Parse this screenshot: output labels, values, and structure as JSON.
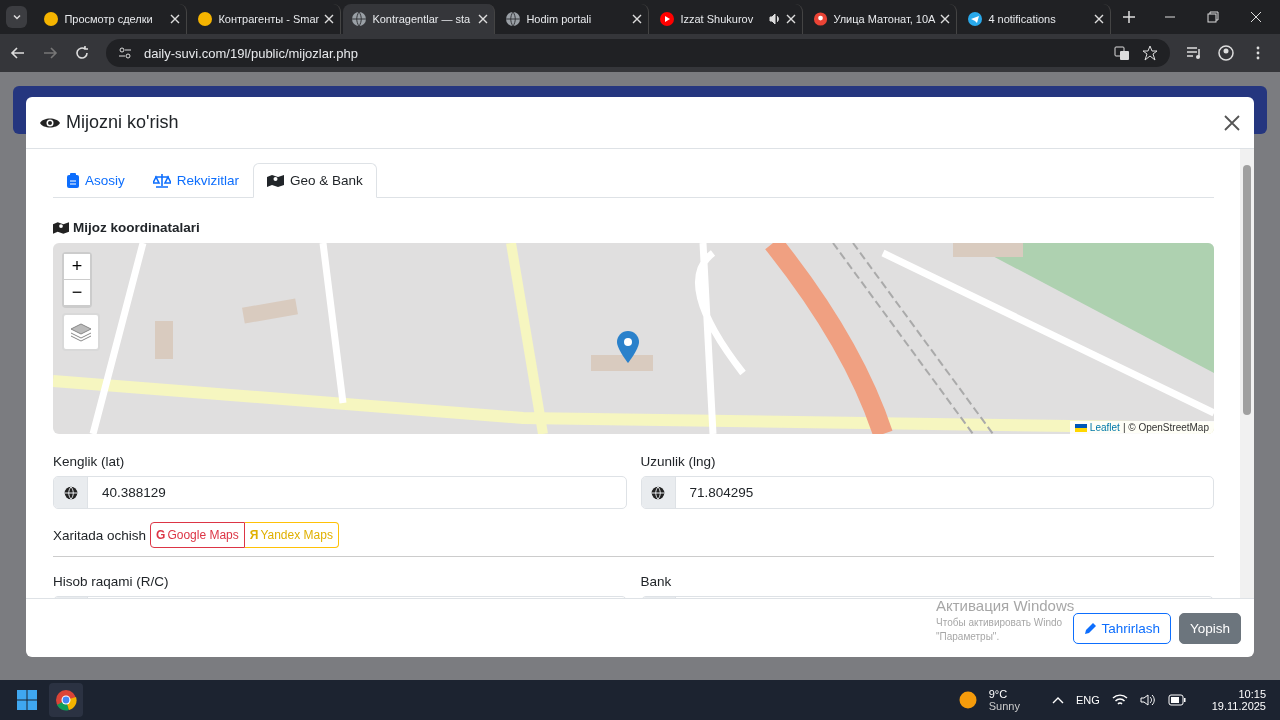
{
  "browser": {
    "tabs": [
      {
        "title": "Просмотр сделки",
        "kind": "app",
        "selected": false,
        "audio": false
      },
      {
        "title": "Контрагенты - Smar",
        "kind": "app",
        "selected": false,
        "audio": false
      },
      {
        "title": "Kontragentlar — sta",
        "kind": "globe",
        "selected": true,
        "audio": false
      },
      {
        "title": "Hodim portali",
        "kind": "globe",
        "selected": false,
        "audio": false
      },
      {
        "title": "Izzat Shukurov",
        "kind": "youtube",
        "selected": false,
        "audio": true
      },
      {
        "title": "Улица Матонат, 10А",
        "kind": "maps",
        "selected": false,
        "audio": false
      },
      {
        "title": "4 notifications",
        "kind": "telegram",
        "selected": false,
        "audio": false
      }
    ],
    "url": "daily-suvi.com/19l/public/mijozlar.php"
  },
  "modal": {
    "title": "Mijozni ko'rish",
    "tabs": [
      {
        "label": "Asosiy",
        "selected": false
      },
      {
        "label": "Rekvizitlar",
        "selected": false
      },
      {
        "label": "Geo & Bank",
        "selected": true
      }
    ],
    "section_title": "Mijoz koordinatalari",
    "map": {
      "zoom_in": "+",
      "zoom_out": "−",
      "attribution_link": "Leaflet",
      "attribution_text": "| © OpenStreetMap"
    },
    "coord_fields": [
      {
        "label": "Kenglik (lat)",
        "value": "40.388129"
      },
      {
        "label": "Uzunlik (lng)",
        "value": "71.804295"
      }
    ],
    "open_in": {
      "label": "Xaritada ochish",
      "links": [
        {
          "label": "Google Maps",
          "icon": "G",
          "kind": "google"
        },
        {
          "label": "Yandex Maps",
          "icon": "Я",
          "kind": "yandex"
        }
      ]
    },
    "bank_fields": [
      {
        "label": "Hisob raqami (R/C)"
      },
      {
        "label": "Bank"
      }
    ],
    "buttons": [
      {
        "label": "Tahrirlash",
        "kind": "outline"
      },
      {
        "label": "Yopish",
        "kind": "secondary"
      }
    ]
  },
  "watermark_notice": [
    "Активация Windows",
    "Чтобы активировать Windo",
    "\"Параметры\"."
  ],
  "taskbar": {
    "temperature": "9°C",
    "weather": "Sunny",
    "language": "ENG",
    "time": "10:15",
    "date": "19.11.2025"
  }
}
